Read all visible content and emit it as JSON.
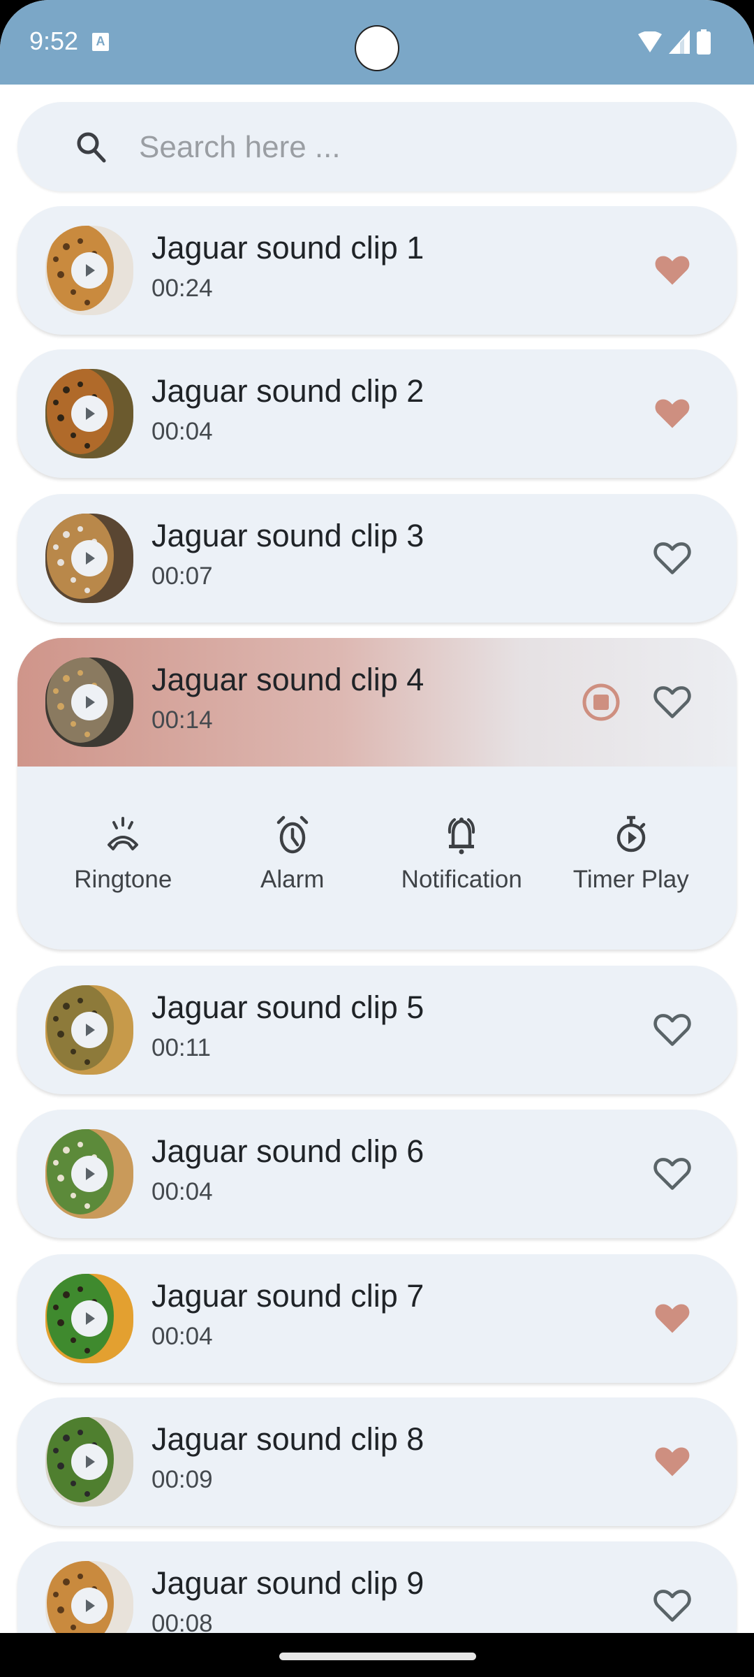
{
  "status_bar": {
    "time": "9:52",
    "notification_icon": "keyboard-a-icon",
    "icons": [
      "wifi-icon",
      "signal-icon",
      "battery-icon"
    ]
  },
  "search": {
    "placeholder": "Search here ...",
    "value": "",
    "icon": "search-icon"
  },
  "colors": {
    "status_bar": "#7BA7C7",
    "card_bg": "#ECF1F7",
    "accent_favorite": "#CE8F80",
    "heart_outline": "#5A6468",
    "playing_gradient_start": "#CF958A"
  },
  "clips": [
    {
      "title": "Jaguar sound clip 1",
      "duration": "00:24",
      "favorite": true,
      "playing": false
    },
    {
      "title": "Jaguar sound clip 2",
      "duration": "00:04",
      "favorite": true,
      "playing": false
    },
    {
      "title": "Jaguar sound clip 3",
      "duration": "00:07",
      "favorite": false,
      "playing": false
    },
    {
      "title": "Jaguar sound clip 4",
      "duration": "00:14",
      "favorite": false,
      "playing": true
    },
    {
      "title": "Jaguar sound clip 5",
      "duration": "00:11",
      "favorite": false,
      "playing": false
    },
    {
      "title": "Jaguar sound clip 6",
      "duration": "00:04",
      "favorite": false,
      "playing": false
    },
    {
      "title": "Jaguar sound clip 7",
      "duration": "00:04",
      "favorite": true,
      "playing": false
    },
    {
      "title": "Jaguar sound clip 8",
      "duration": "00:09",
      "favorite": true,
      "playing": false
    },
    {
      "title": "Jaguar sound clip 9",
      "duration": "00:08",
      "favorite": false,
      "playing": false
    }
  ],
  "expanded_actions": [
    {
      "label": "Ringtone",
      "icon": "ringtone-icon"
    },
    {
      "label": "Alarm",
      "icon": "alarm-icon"
    },
    {
      "label": "Notification",
      "icon": "notification-bell-icon"
    },
    {
      "label": "Timer Play",
      "icon": "timer-play-icon"
    }
  ]
}
